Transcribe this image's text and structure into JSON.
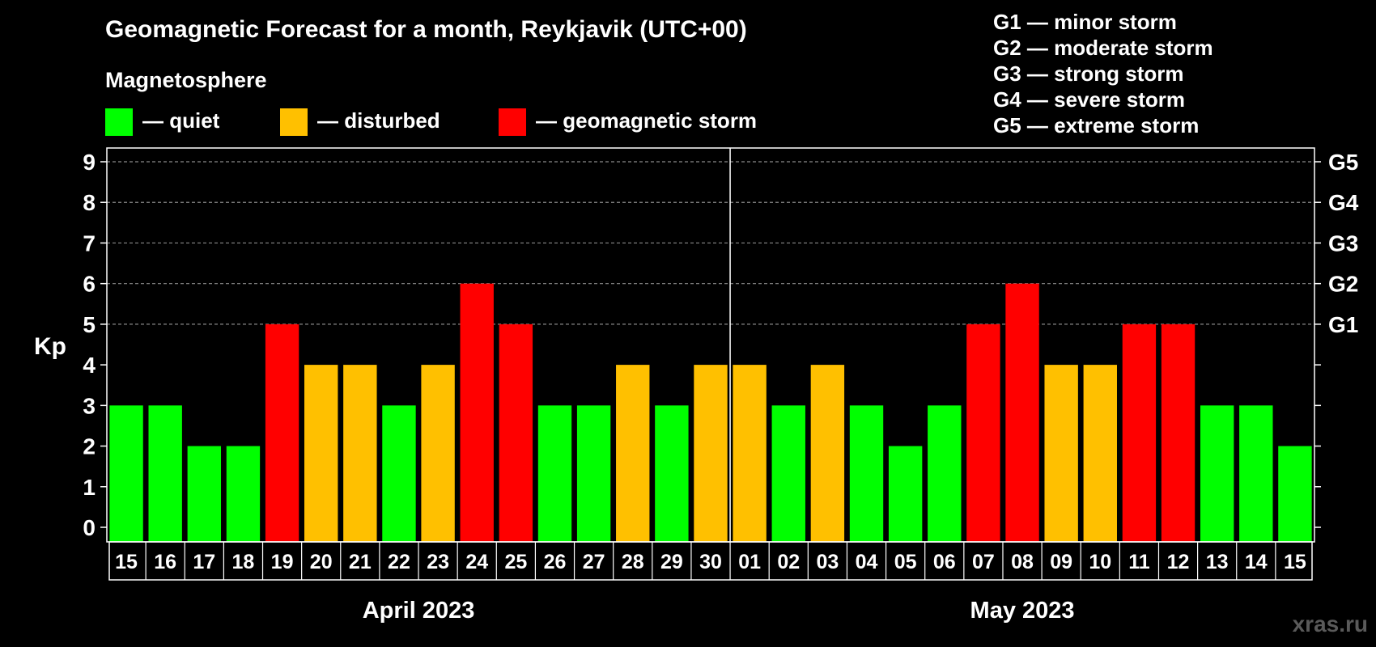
{
  "title": "Geomagnetic Forecast for a month, Reykjavik (UTC+00)",
  "magnetosphere": {
    "heading": "Magnetosphere",
    "items": [
      {
        "label": "— quiet",
        "color": "#00ff00"
      },
      {
        "label": "— disturbed",
        "color": "#ffc000"
      },
      {
        "label": "— geomagnetic storm",
        "color": "#ff0000"
      }
    ]
  },
  "storm_scale": [
    "G1 — minor storm",
    "G2 — moderate storm",
    "G3 — strong storm",
    "G4 — severe storm",
    "G5 — extreme storm"
  ],
  "watermark": "xras.ru",
  "chart_data": {
    "type": "bar",
    "ylabel": "Kp",
    "ylim": [
      0,
      9
    ],
    "yticks": [
      "0",
      "1",
      "2",
      "3",
      "4",
      "5",
      "6",
      "7",
      "8",
      "9"
    ],
    "right_axis_ticks": [
      {
        "value": 5,
        "label": "G1"
      },
      {
        "value": 6,
        "label": "G2"
      },
      {
        "value": 7,
        "label": "G3"
      },
      {
        "value": 8,
        "label": "G4"
      },
      {
        "value": 9,
        "label": "G5"
      }
    ],
    "grid": "horizontal dashed at 5-9",
    "categories": [
      "15",
      "16",
      "17",
      "18",
      "19",
      "20",
      "21",
      "22",
      "23",
      "24",
      "25",
      "26",
      "27",
      "28",
      "29",
      "30",
      "01",
      "02",
      "03",
      "04",
      "05",
      "06",
      "07",
      "08",
      "09",
      "10",
      "11",
      "12",
      "13",
      "14",
      "15"
    ],
    "values": [
      3,
      3,
      2,
      2,
      5,
      4,
      4,
      3,
      4,
      6,
      5,
      3,
      3,
      4,
      3,
      4,
      4,
      3,
      4,
      3,
      2,
      3,
      5,
      6,
      4,
      4,
      5,
      5,
      3,
      3,
      2
    ],
    "months": [
      {
        "label": "April 2023",
        "first_index": 0,
        "last_index": 15
      },
      {
        "label": "May 2023",
        "first_index": 16,
        "last_index": 30
      }
    ],
    "colors": {
      "quiet": "#00ff00",
      "disturbed": "#ffc000",
      "storm": "#ff0000"
    },
    "color_rule": "Kp <= 3 quiet, Kp = 4 disturbed, Kp >= 5 storm"
  }
}
